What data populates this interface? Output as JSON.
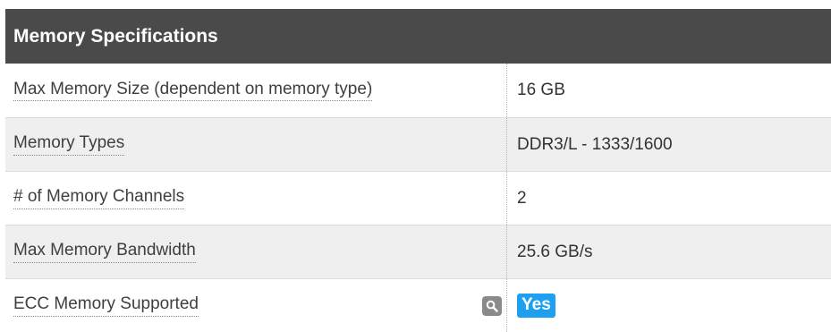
{
  "section": {
    "title": "Memory Specifications"
  },
  "rows": [
    {
      "label": "Max Memory Size (dependent on memory type)",
      "value": "16 GB"
    },
    {
      "label": "Memory Types",
      "value": "DDR3/L - 1333/1600"
    },
    {
      "label": "# of Memory Channels",
      "value": "2"
    },
    {
      "label": "Max Memory Bandwidth",
      "value": "25.6 GB/s"
    },
    {
      "label": "ECC Memory Supported",
      "value": "Yes",
      "icon": "search-icon"
    }
  ],
  "colors": {
    "header_bg": "#4a4a4a",
    "shaded_row_bg": "#efefef",
    "yes_badge": "#1f9ff0"
  }
}
